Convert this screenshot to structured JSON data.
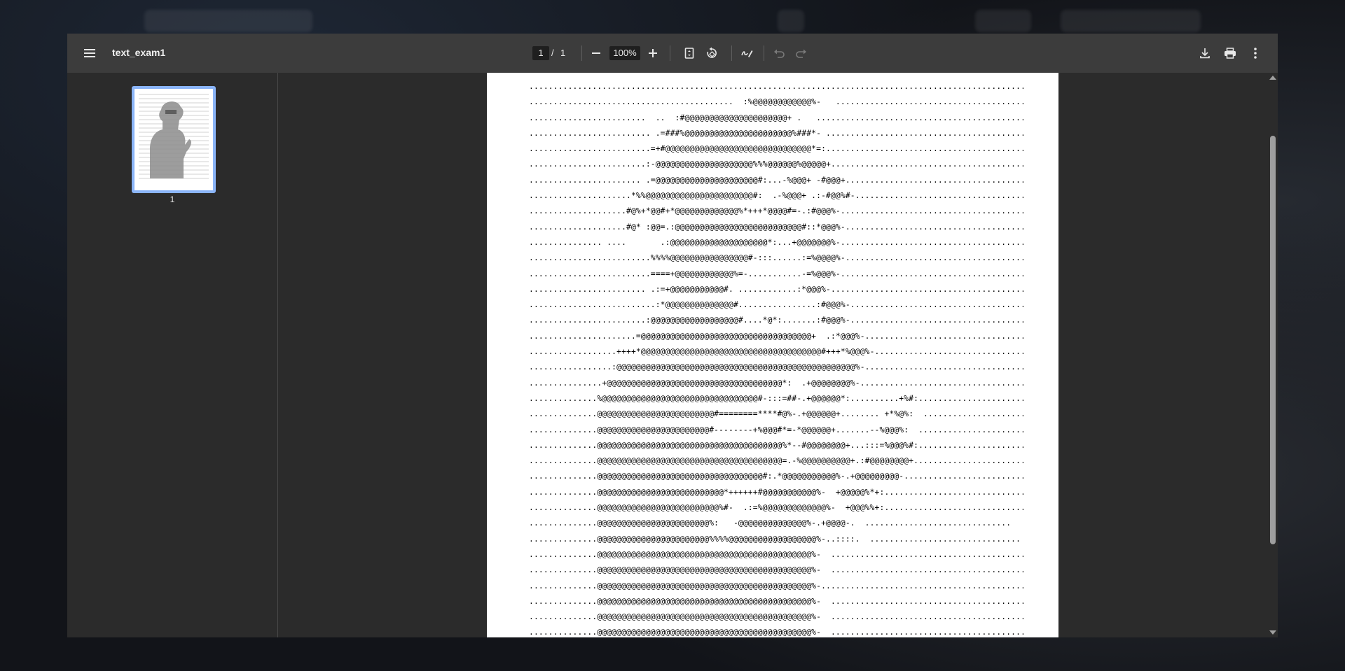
{
  "toolbar": {
    "menu_icon": "hamburger-menu-icon",
    "title": "text_exam1",
    "current_page": "1",
    "page_separator": "/",
    "total_pages": "1",
    "zoom_out_icon": "minus-icon",
    "zoom": "100%",
    "zoom_in_icon": "plus-icon",
    "fit_page_icon": "fit-page-icon",
    "rotate_icon": "rotate-counterclockwise-icon",
    "annotate_icon": "draw-icon",
    "undo_icon": "undo-icon",
    "redo_icon": "redo-icon",
    "download_icon": "download-icon",
    "print_icon": "print-icon",
    "more_icon": "more-vertical-icon"
  },
  "sidebar": {
    "thumbnail_page_number": "1"
  },
  "document": {
    "ascii_lines": [
      ".........................................................................................................",
      "..........................................  :%@@@@@@@@@@@@%-   ................................................",
      "........................  ..  :#@@@@@@@@@@@@@@@@@@@@@+ .   ...............................................",
      "......................... .=###%@@@@@@@@@@@@@@@@@@@@@@%###*- .............................................",
      ".........................=+#@@@@@@@@@@@@@@@@@@@@@@@@@@@@@@*=:.............................................",
      "........................:-@@@@@@@@@@@@@@@@@@@@%%%@@@@@@%@@@@@+.............................................",
      "....................... .=@@@@@@@@@@@@@@@@@@@@@#:...-%@@@+ -#@@@+..........................................",
      ".....................*%%@@@@@@@@@@@@@@@@@@@@@@#:  .-%@@@+ .:-#@@%#-.........................................",
      "....................#@%+*@@#+*@@@@@@@@@@@@@%*+++*@@@@#=-.:#@@@%-...........................................",
      "....................#@* :@@=.:@@@@@@@@@@@@@@@@@@@@@@@@@@#::*@@@%-...........................................",
      "............... ....       .:@@@@@@@@@@@@@@@@@@@@*:...+@@@@@@@%-...........................................",
      ".........................%%%%@@@@@@@@@@@@@@@@#-:::......:=%@@@@%-...........................................",
      ".........................====+@@@@@@@@@@@@%=-...........-=%@@@%-...........................................",
      "........................ .:=+@@@@@@@@@@@#. ............:*@@@%-.............................................",
      "..........................:*@@@@@@@@@@@@@@#................:#@@@%-...........................................",
      "........................:@@@@@@@@@@@@@@@@@@#....*@*:.......:#@@@%-...........................................",
      "......................=@@@@@@@@@@@@@@@@@@@@@@@@@@@@@@@@@@@+  .:*@@@%-...........................................",
      "..................++++*@@@@@@@@@@@@@@@@@@@@@@@@@@@@@@@@@@@@@#+++*%@@@%-.........................................",
      ".................:@@@@@@@@@@@@@@@@@@@@@@@@@@@@@@@@@@@@@@@@@@@@@@@@@%-...........................................",
      "...............+@@@@@@@@@@@@@@@@@@@@@@@@@@@@@@@@@@@@*:  .+@@@@@@@@%-.........................................",
      "..............%@@@@@@@@@@@@@@@@@@@@@@@@@@@@@@@@#-:::=##-.+@@@@@@*:..........+%#:.............................",
      "..............@@@@@@@@@@@@@@@@@@@@@@@@#========****#@%-.+@@@@@@+........ +*%@%:  ............................",
      "..............@@@@@@@@@@@@@@@@@@@@@@@#--------+%@@@#*=-*@@@@@@+.......--%@@@%:  ............................",
      "..............@@@@@@@@@@@@@@@@@@@@@@@@@@@@@@@@@@@@@@%*--#@@@@@@@@+...:::=%@@@%#:.............................",
      "..............@@@@@@@@@@@@@@@@@@@@@@@@@@@@@@@@@@@@@@=.-%@@@@@@@@@@+.:#@@@@@@@@+..............................",
      "..............@@@@@@@@@@@@@@@@@@@@@@@@@@@@@@@@@@#:.*@@@@@@@@@@@%-.+@@@@@@@@@-...............................",
      "..............@@@@@@@@@@@@@@@@@@@@@@@@@@*++++++#@@@@@@@@@@@%-  +@@@@@%*+:.................................",
      "..............@@@@@@@@@@@@@@@@@@@@@@@@@%#-  .:=%@@@@@@@@@@@@@%-  +@@@%%+:.................................",
      "..............@@@@@@@@@@@@@@@@@@@@@@@%:   -@@@@@@@@@@@@@@%-.+@@@@-.  ..............................",
      "..............@@@@@@@@@@@@@@@@@@@@@@@%%%%@@@@@@@@@@@@@@@@@@%-..::::.  ...............................",
      "..............@@@@@@@@@@@@@@@@@@@@@@@@@@@@@@@@@@@@@@@@@@@@%-  ..............................................",
      "..............@@@@@@@@@@@@@@@@@@@@@@@@@@@@@@@@@@@@@@@@@@@@%-  ..............................................",
      "..............@@@@@@@@@@@@@@@@@@@@@@@@@@@@@@@@@@@@@@@@@@@@%-................................................",
      "..............@@@@@@@@@@@@@@@@@@@@@@@@@@@@@@@@@@@@@@@@@@@@%-  ..............................................",
      "..............@@@@@@@@@@@@@@@@@@@@@@@@@@@@@@@@@@@@@@@@@@@@%-  ..............................................",
      "..............@@@@@@@@@@@@@@@@@@@@@@@@@@@@@@@@@@@@@@@@@@@@%-  .............................................."
    ]
  },
  "colors": {
    "toolbar_bg": "#3c3c3c",
    "viewer_bg": "#2b2b2b",
    "thumbnail_border": "#8ab4f8",
    "page_bg": "#ffffff"
  }
}
